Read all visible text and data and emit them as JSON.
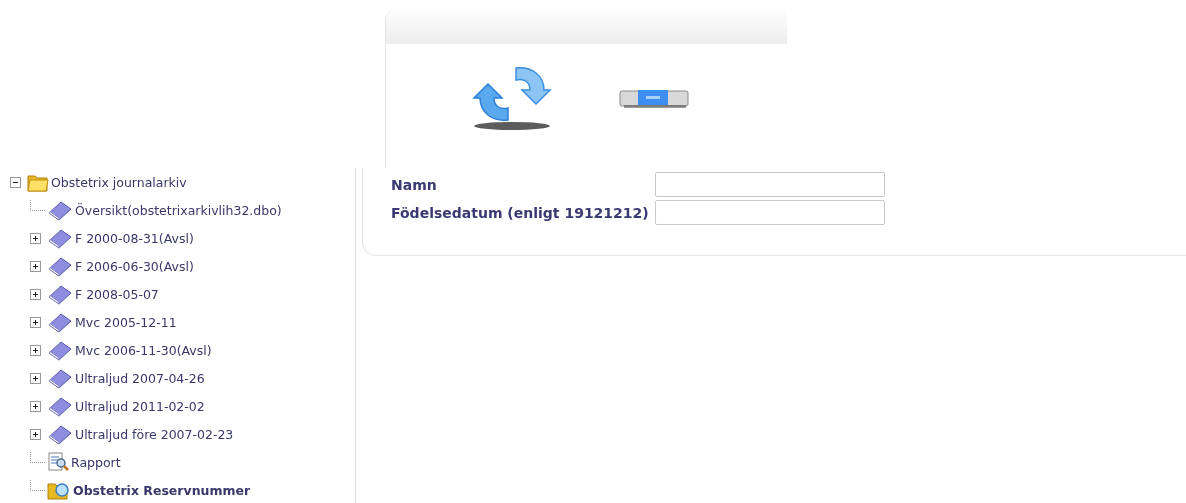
{
  "toolbar": {
    "buttons": [
      {
        "kind": "refresh"
      },
      {
        "kind": "minimize"
      }
    ]
  },
  "tree": {
    "root": {
      "label": "Obstetrix journalarkiv",
      "kind": "folder",
      "expanded": true,
      "children": [
        {
          "label": "Översikt(obstetrixarkivlih32.dbo)",
          "kind": "book",
          "leaf": true,
          "selected": false
        },
        {
          "label": "F 2000-08-31(Avsl)",
          "kind": "book",
          "leaf": false,
          "expanded": false,
          "selected": false
        },
        {
          "label": "F 2006-06-30(Avsl)",
          "kind": "book",
          "leaf": false,
          "expanded": false,
          "selected": false
        },
        {
          "label": "F 2008-05-07",
          "kind": "book",
          "leaf": false,
          "expanded": false,
          "selected": false
        },
        {
          "label": "Mvc 2005-12-11",
          "kind": "book",
          "leaf": false,
          "expanded": false,
          "selected": false
        },
        {
          "label": "Mvc 2006-11-30(Avsl)",
          "kind": "book",
          "leaf": false,
          "expanded": false,
          "selected": false
        },
        {
          "label": "Ultraljud 2007-04-26",
          "kind": "book",
          "leaf": false,
          "expanded": false,
          "selected": false
        },
        {
          "label": "Ultraljud 2011-02-02",
          "kind": "book",
          "leaf": false,
          "expanded": false,
          "selected": false
        },
        {
          "label": "Ultraljud före 2007-02-23",
          "kind": "book",
          "leaf": false,
          "expanded": false,
          "selected": false
        },
        {
          "label": "Rapport",
          "kind": "report",
          "leaf": true,
          "selected": false
        },
        {
          "label": "Obstetrix Reservnummer",
          "kind": "search",
          "leaf": true,
          "selected": true
        }
      ]
    }
  },
  "form": {
    "fields": [
      {
        "label": "Namn"
      },
      {
        "label": "Födelsedatum (enligt 19121212)"
      }
    ]
  }
}
